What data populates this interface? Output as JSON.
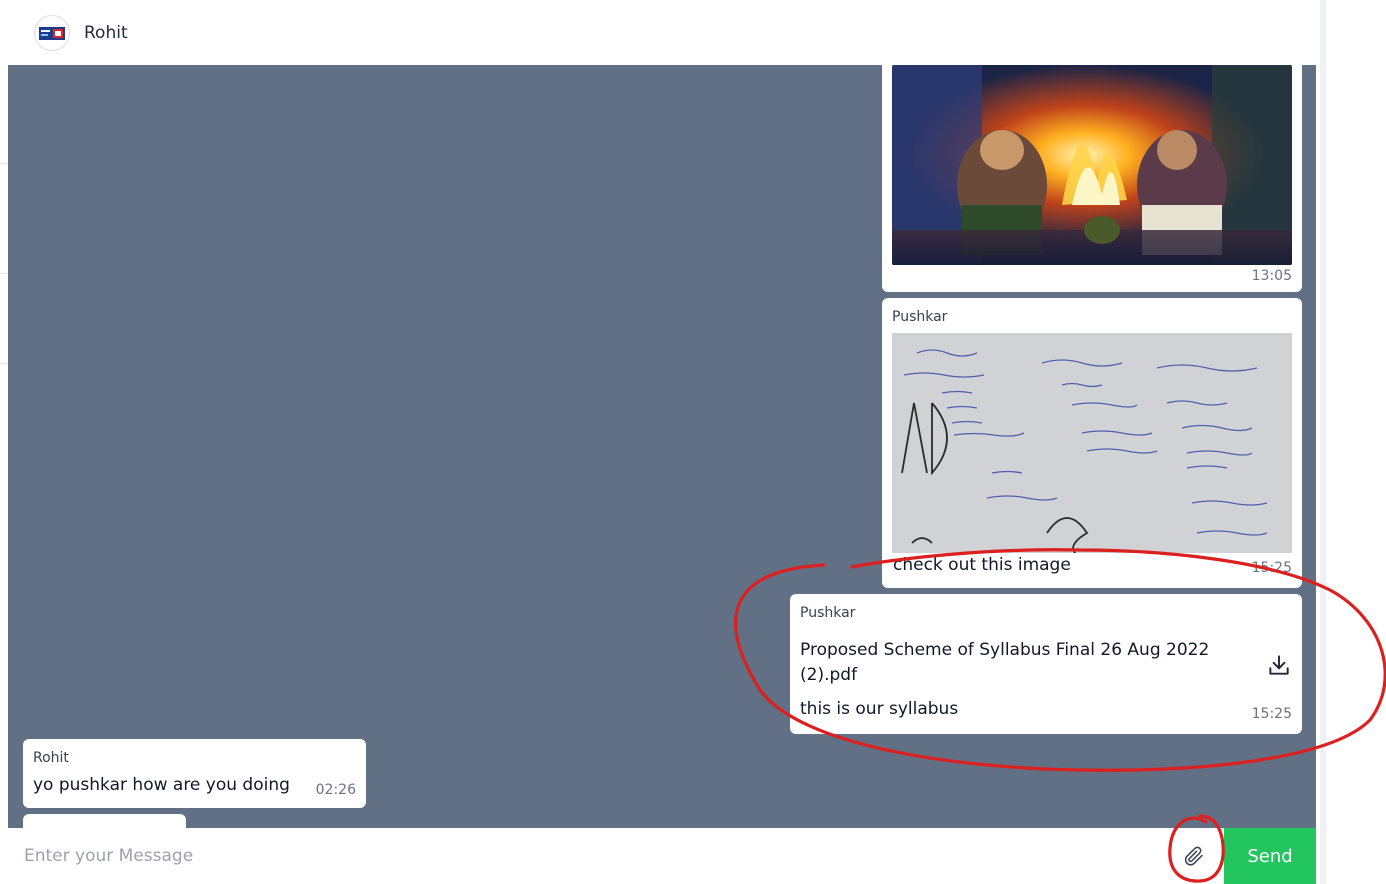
{
  "header": {
    "contact_name": "Rohit"
  },
  "messages": [
    {
      "type": "image",
      "image_icon": "fantasy-artwork-image",
      "time": "13:05"
    },
    {
      "type": "image-caption",
      "sender": "Pushkar",
      "image_icon": "whiteboard-photo-image",
      "caption": "check out this image",
      "time": "15:25"
    },
    {
      "type": "file",
      "sender": "Pushkar",
      "file_name": "Proposed Scheme of Syllabus Final 26 Aug 2022 (2).pdf",
      "download_icon": "download-icon",
      "caption": "this is our syllabus",
      "time": "15:25"
    },
    {
      "type": "text",
      "sender": "Rohit",
      "text": "yo pushkar how are you doing",
      "time": "02:26"
    }
  ],
  "composer": {
    "placeholder": "Enter your Message",
    "attach_icon": "paperclip-icon",
    "send_label": "Send"
  },
  "colors": {
    "chat_background": "#627086",
    "send_button": "#22c55e",
    "annotation": "#dc1f1f"
  }
}
